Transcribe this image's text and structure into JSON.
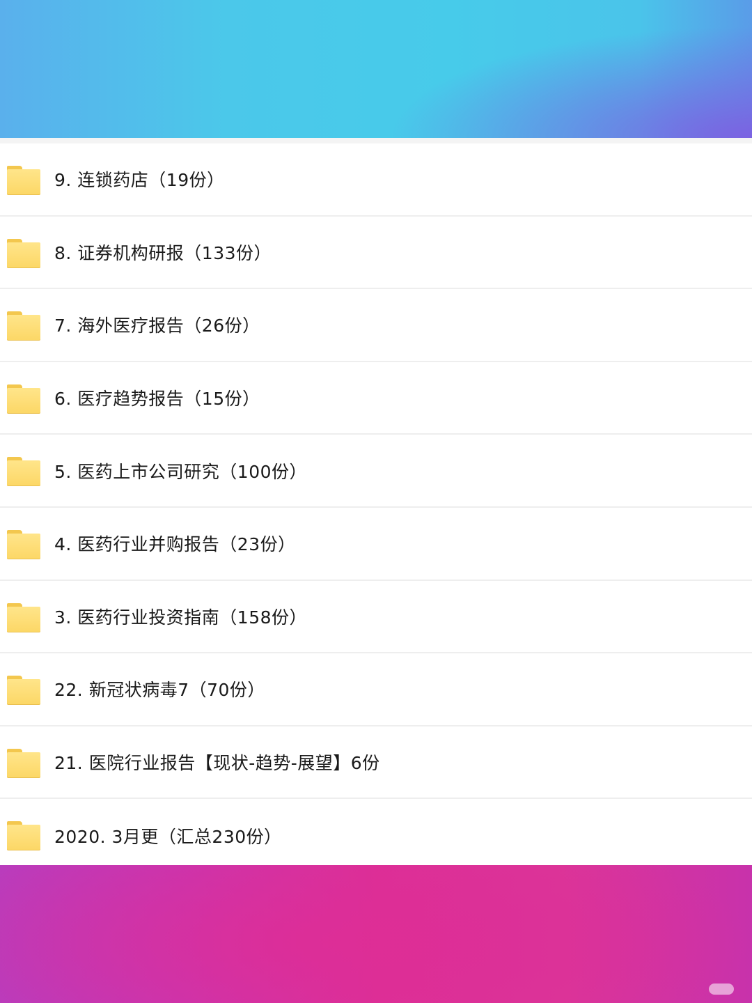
{
  "folders": [
    {
      "label": "9. 连锁药店（19份）",
      "icon": "folder-icon"
    },
    {
      "label": "8. 证券机构研报（133份）",
      "icon": "folder-icon"
    },
    {
      "label": "7. 海外医疗报告（26份）",
      "icon": "folder-icon"
    },
    {
      "label": "6. 医疗趋势报告（15份）",
      "icon": "folder-icon"
    },
    {
      "label": "5. 医药上市公司研究（100份）",
      "icon": "folder-icon"
    },
    {
      "label": "4. 医药行业并购报告（23份）",
      "icon": "folder-icon"
    },
    {
      "label": "3. 医药行业投资指南（158份）",
      "icon": "folder-icon"
    },
    {
      "label": "22. 新冠状病毒7（70份）",
      "icon": "folder-icon"
    },
    {
      "label": "21. 医院行业报告【现状-趋势-展望】6份",
      "icon": "folder-icon"
    },
    {
      "label": "2020. 3月更（汇总230份）",
      "icon": "folder-icon"
    }
  ],
  "colors": {
    "folder": "#fcd766",
    "top_banner": "#47cbea",
    "bottom_banner": "#dc2f97"
  }
}
